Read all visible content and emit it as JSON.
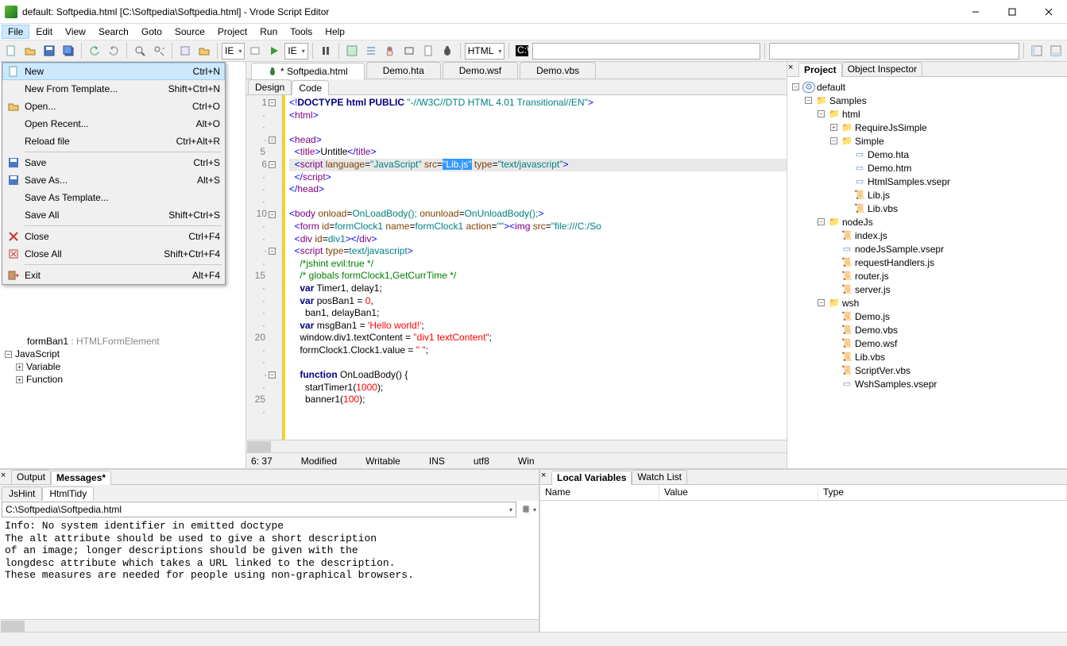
{
  "window": {
    "title": "default: Softpedia.html [C:\\Softpedia\\Softpedia.html] - Vrode Script Editor"
  },
  "menubar": [
    "File",
    "Edit",
    "View",
    "Search",
    "Goto",
    "Source",
    "Project",
    "Run",
    "Tools",
    "Help"
  ],
  "filemenu": [
    {
      "icon": "new",
      "label": "New",
      "shortcut": "Ctrl+N",
      "hl": true
    },
    {
      "icon": "",
      "label": "New From Template...",
      "shortcut": "Shift+Ctrl+N"
    },
    {
      "icon": "open",
      "label": "Open...",
      "shortcut": "Ctrl+O"
    },
    {
      "icon": "",
      "label": "Open Recent...",
      "shortcut": "Alt+O"
    },
    {
      "icon": "",
      "label": "Reload file",
      "shortcut": "Ctrl+Alt+R"
    },
    {
      "sep": true
    },
    {
      "icon": "save",
      "label": "Save",
      "shortcut": "Ctrl+S"
    },
    {
      "icon": "saveas",
      "label": "Save As...",
      "shortcut": "Alt+S"
    },
    {
      "icon": "",
      "label": "Save As Template...",
      "shortcut": ""
    },
    {
      "icon": "",
      "label": "Save All",
      "shortcut": "Shift+Ctrl+S"
    },
    {
      "sep": true
    },
    {
      "icon": "close",
      "label": "Close",
      "shortcut": "Ctrl+F4"
    },
    {
      "icon": "closeall",
      "label": "Close All",
      "shortcut": "Shift+Ctrl+F4"
    },
    {
      "sep": true
    },
    {
      "icon": "exit",
      "label": "Exit",
      "shortcut": "Alt+F4"
    }
  ],
  "toolbar": {
    "lang1": "IE",
    "lang2": "IE",
    "lang3": "HTML"
  },
  "left_tree": {
    "row1": {
      "name": "formBan1",
      "type": ": HTMLFormElement"
    },
    "row2": "JavaScript",
    "row3": "Variable",
    "row4": "Function"
  },
  "file_tabs": [
    {
      "label": "* Softpedia.html",
      "active": true,
      "bug": true
    },
    {
      "label": "Demo.hta"
    },
    {
      "label": "Demo.wsf"
    },
    {
      "label": "Demo.vbs"
    }
  ],
  "view_tabs": [
    "Design",
    "Code"
  ],
  "code_lines": [
    {
      "n": "1",
      "fold": true,
      "html": "<span class='k-blue'>&lt;!</span><span class='k-navy'>DOCTYPE</span> <span class='k-navy'>html PUBLIC</span> <span class='k-teal'>\"-//W3C//DTD HTML 4.01 Transitional//EN\"</span><span class='k-blue'>&gt;</span>"
    },
    {
      "n": "",
      "html": "<span class='k-blue'>&lt;</span><span class='k-purple'>html</span><span class='k-blue'>&gt;</span>"
    },
    {
      "n": "",
      "html": ""
    },
    {
      "n": "",
      "fold": true,
      "html": "<span class='k-blue'>&lt;</span><span class='k-purple'>head</span><span class='k-blue'>&gt;</span>"
    },
    {
      "n": "5",
      "html": "  <span class='k-blue'>&lt;</span><span class='k-purple'>title</span><span class='k-blue'>&gt;</span>Untitle<span class='k-blue'>&lt;/</span><span class='k-purple'>title</span><span class='k-blue'>&gt;</span>"
    },
    {
      "n": "6",
      "fold": true,
      "sel": true,
      "html": "  <span class='k-blue'>&lt;</span><span class='k-purple'>script</span> <span class='k-brown'>language</span>=<span class='k-teal'>\"JavaScript\"</span> <span class='k-brown'>src</span>=<span class='k-sel'>\"Lib.js\"</span> <span class='k-brown'>type</span>=<span class='k-teal'>\"text/javascript\"</span><span class='k-blue'>&gt;</span>"
    },
    {
      "n": "",
      "html": "  <span class='k-blue'>&lt;/</span><span class='k-purple'>script</span><span class='k-blue'>&gt;</span>"
    },
    {
      "n": "",
      "html": "<span class='k-blue'>&lt;/</span><span class='k-purple'>head</span><span class='k-blue'>&gt;</span>"
    },
    {
      "n": "",
      "html": ""
    },
    {
      "n": "10",
      "fold": true,
      "html": "<span class='k-blue'>&lt;</span><span class='k-purple'>body</span> <span class='k-brown'>onload</span>=<span class='k-teal'>OnLoadBody();</span> <span class='k-brown'>onunload</span>=<span class='k-teal'>OnUnloadBody();</span><span class='k-blue'>&gt;</span>"
    },
    {
      "n": "",
      "html": "  <span class='k-blue'>&lt;</span><span class='k-purple'>form</span> <span class='k-brown'>id</span>=<span class='k-teal'>formClock1</span> <span class='k-brown'>name</span>=<span class='k-teal'>formClock1</span> <span class='k-brown'>action</span>=<span class='k-teal'>\"\"</span><span class='k-blue'>&gt;&lt;</span><span class='k-purple'>img</span> <span class='k-brown'>src</span>=<span class='k-teal'>\"file:///C:/So</span>"
    },
    {
      "n": "",
      "html": "  <span class='k-blue'>&lt;</span><span class='k-purple'>div</span> <span class='k-brown'>id</span>=<span class='k-teal'>div1</span><span class='k-blue'>&gt;&lt;/</span><span class='k-purple'>div</span><span class='k-blue'>&gt;</span>"
    },
    {
      "n": "",
      "fold": true,
      "html": "  <span class='k-blue'>&lt;</span><span class='k-purple'>script</span> <span class='k-brown'>type</span>=<span class='k-teal'>text/javascript</span><span class='k-blue'>&gt;</span>"
    },
    {
      "n": "",
      "html": "    <span class='k-green'>/*jshint evil:true */</span>"
    },
    {
      "n": "15",
      "html": "    <span class='k-green'>/* globals formClock1,GetCurrTime */</span>"
    },
    {
      "n": "",
      "html": "    <span class='k-navy'>var</span> Timer1, delay1;"
    },
    {
      "n": "",
      "html": "    <span class='k-navy'>var</span> posBan1 = <span class='k-red'>0</span>,"
    },
    {
      "n": "",
      "html": "      ban1, delayBan1;"
    },
    {
      "n": "",
      "html": "    <span class='k-navy'>var</span> msgBan1 = <span class='k-red'>'Hello world!'</span>;"
    },
    {
      "n": "20",
      "html": "    window.div1.textContent = <span class='k-red'>\"div1 textContent\"</span>;"
    },
    {
      "n": "",
      "html": "    formClock1.Clock1.value = <span class='k-red'>\" \"</span>;"
    },
    {
      "n": "",
      "html": ""
    },
    {
      "n": "",
      "fold": true,
      "html": "    <span class='k-navy'>function</span> OnLoadBody() {"
    },
    {
      "n": "",
      "html": "      startTimer1(<span class='k-red'>1000</span>);"
    },
    {
      "n": "25",
      "html": "      banner1(<span class='k-red'>100</span>);"
    },
    {
      "n": "",
      "html": "    "
    }
  ],
  "status": {
    "pos": "6: 37",
    "mod": "Modified",
    "wr": "Writable",
    "ins": "INS",
    "enc": "utf8",
    "eol": "Win"
  },
  "right_tabs": [
    "Project",
    "Object Inspector"
  ],
  "project_tree": [
    {
      "d": 0,
      "exp": "-",
      "ic": "prj",
      "label": "default"
    },
    {
      "d": 1,
      "exp": "-",
      "ic": "folder",
      "label": "Samples"
    },
    {
      "d": 2,
      "exp": "-",
      "ic": "folder",
      "label": "html"
    },
    {
      "d": 3,
      "exp": "+",
      "ic": "folder",
      "label": "RequireJsSimple"
    },
    {
      "d": 3,
      "exp": "-",
      "ic": "folder",
      "label": "Simple"
    },
    {
      "d": 4,
      "exp": "",
      "ic": "file",
      "label": "Demo.hta"
    },
    {
      "d": 4,
      "exp": "",
      "ic": "file",
      "label": "Demo.htm"
    },
    {
      "d": 4,
      "exp": "",
      "ic": "file",
      "label": "HtmlSamples.vsepr"
    },
    {
      "d": 4,
      "exp": "",
      "ic": "js",
      "label": "Lib.js"
    },
    {
      "d": 4,
      "exp": "",
      "ic": "js",
      "label": "Lib.vbs"
    },
    {
      "d": 2,
      "exp": "-",
      "ic": "folder",
      "label": "nodeJs"
    },
    {
      "d": 3,
      "exp": "",
      "ic": "js",
      "label": "index.js"
    },
    {
      "d": 3,
      "exp": "",
      "ic": "file",
      "label": "nodeJsSample.vsepr"
    },
    {
      "d": 3,
      "exp": "",
      "ic": "js",
      "label": "requestHandlers.js"
    },
    {
      "d": 3,
      "exp": "",
      "ic": "js",
      "label": "router.js"
    },
    {
      "d": 3,
      "exp": "",
      "ic": "js",
      "label": "server.js"
    },
    {
      "d": 2,
      "exp": "-",
      "ic": "folder",
      "label": "wsh"
    },
    {
      "d": 3,
      "exp": "",
      "ic": "js",
      "label": "Demo.js"
    },
    {
      "d": 3,
      "exp": "",
      "ic": "js",
      "label": "Demo.vbs"
    },
    {
      "d": 3,
      "exp": "",
      "ic": "js",
      "label": "Demo.wsf"
    },
    {
      "d": 3,
      "exp": "",
      "ic": "js",
      "label": "Lib.vbs"
    },
    {
      "d": 3,
      "exp": "",
      "ic": "js",
      "label": "ScriptVer.vbs"
    },
    {
      "d": 3,
      "exp": "",
      "ic": "file",
      "label": "WshSamples.vsepr"
    }
  ],
  "bottom_left": {
    "tabs": [
      "Output",
      "Messages*"
    ],
    "subtabs": [
      "JsHint",
      "HtmlTidy"
    ],
    "path": "C:\\Softpedia\\Softpedia.html",
    "msg": "Info: No system identifier in emitted doctype\nThe alt attribute should be used to give a short description\nof an image; longer descriptions should be given with the\nlongdesc attribute which takes a URL linked to the description.\nThese measures are needed for people using non-graphical browsers."
  },
  "bottom_right": {
    "tabs": [
      "Local Variables",
      "Watch List"
    ],
    "cols": [
      "Name",
      "Value",
      "Type"
    ]
  }
}
